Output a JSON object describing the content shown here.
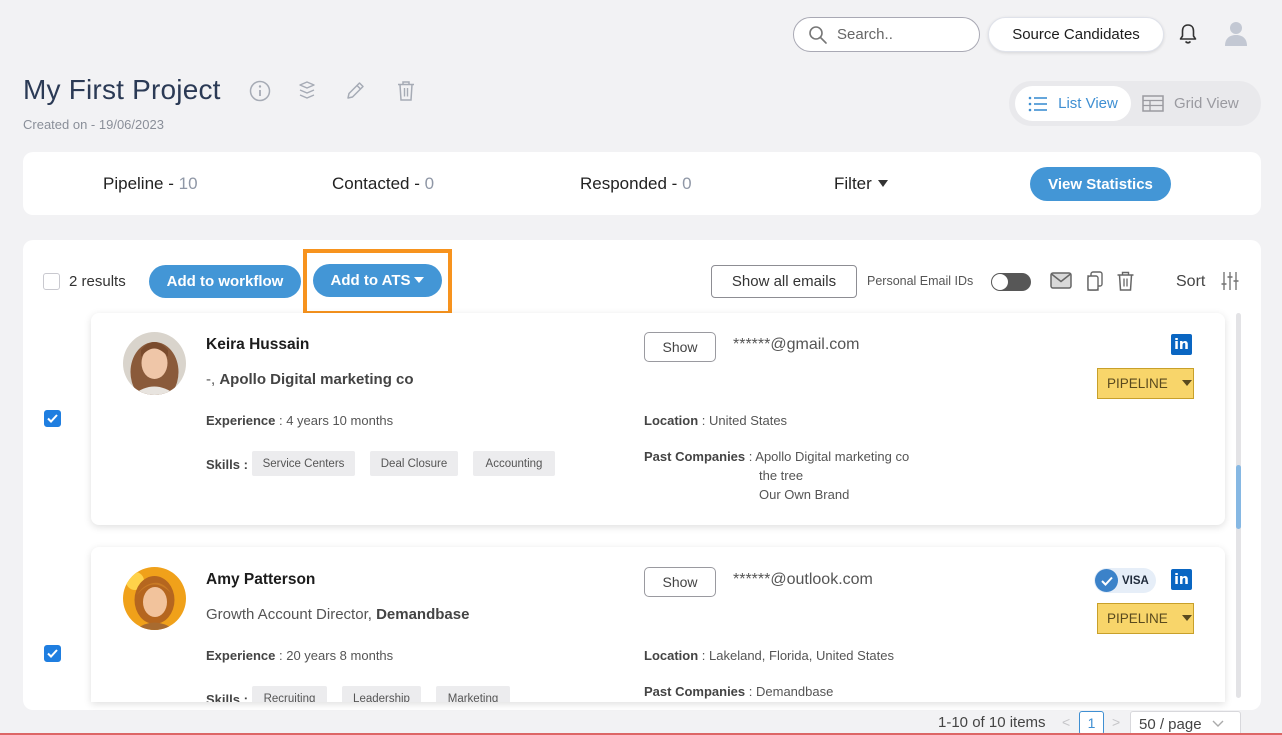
{
  "topbar": {
    "search_placeholder": "Search..",
    "source_candidates": "Source Candidates"
  },
  "project": {
    "title": "My First Project",
    "created": "Created on - 19/06/2023"
  },
  "view_toggle": {
    "list": "List View",
    "grid": "Grid View",
    "active": "list"
  },
  "stats": {
    "pipeline_label": "Pipeline - ",
    "pipeline_count": "10",
    "contacted_label": "Contacted - ",
    "contacted_count": "0",
    "responded_label": "Responded - ",
    "responded_count": "0",
    "filter": "Filter",
    "view_statistics": "View Statistics"
  },
  "toolbar": {
    "results": "2 results",
    "add_workflow": "Add to workflow",
    "add_ats": "Add to ATS",
    "show_all_emails": "Show all emails",
    "personal_email_ids": "Personal Email IDs",
    "personal_email_toggle": false,
    "sort": "Sort"
  },
  "candidates": [
    {
      "name": "Keira Hussain",
      "role_prefix": "-, ",
      "company": "Apollo Digital marketing co",
      "experience_label": "Experience",
      "experience": " : 4 years 10 months",
      "skills_label": "Skills :",
      "skills": [
        "Service Centers",
        "Deal Closure",
        "Accounting"
      ],
      "show": "Show",
      "email": "******@gmail.com",
      "location_label": "Location",
      "location": " : United States",
      "past_label": "Past Companies",
      "past_companies": [
        " : Apollo Digital marketing co",
        "the tree",
        "Our Own Brand"
      ],
      "stage": "PIPELINE",
      "linkedin": "in",
      "checked": true
    },
    {
      "name": "Amy Patterson",
      "role_prefix": "Growth Account Director, ",
      "company": "Demandbase",
      "experience_label": "Experience",
      "experience": " : 20 years 8 months",
      "skills_label": "Skills :",
      "skills": [
        "Recruiting",
        "Leadership",
        "Marketing"
      ],
      "show": "Show",
      "email": "******@outlook.com",
      "location_label": "Location",
      "location": " : Lakeland, Florida, United States",
      "past_label": "Past Companies",
      "past_companies": [
        " : Demandbase"
      ],
      "stage": "PIPELINE",
      "visa": "VISA",
      "linkedin": "in",
      "checked": true
    }
  ],
  "pagination": {
    "range": "1-10 of 10 items",
    "page": "1",
    "per_page": "50 / page"
  },
  "colors": {
    "accent": "#4396d6",
    "highlight": "#f7931e",
    "pipeline": "#f8d56a",
    "linkedin": "#0a66c2"
  }
}
